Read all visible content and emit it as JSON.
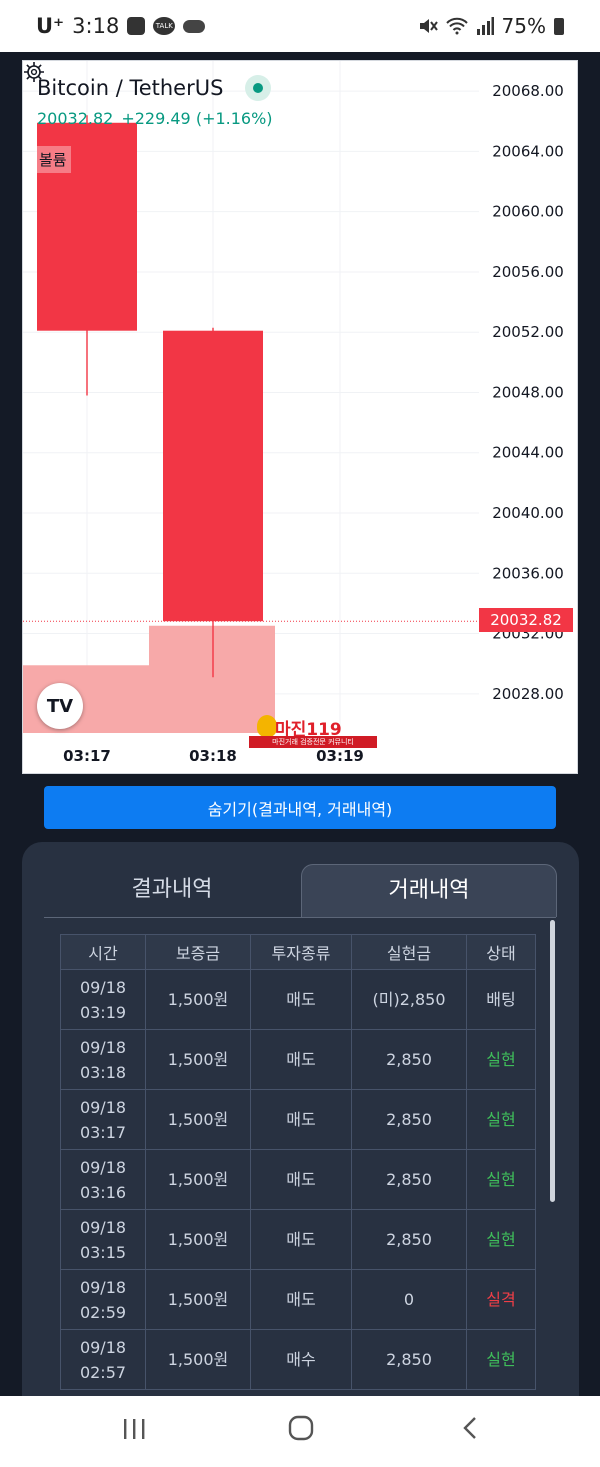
{
  "status_bar": {
    "carrier": "U⁺",
    "time": "3:18",
    "talk_icon_text": "TALK",
    "battery": "75%"
  },
  "chart": {
    "pair": "Bitcoin / TetherUS",
    "price": "20032.82",
    "change": "+229.49 (+1.16%)",
    "volume_label": "볼륨",
    "last_price_tag": "20032.82",
    "brand_logo_text": "TV"
  },
  "watermark": {
    "text": "마진119",
    "subtext": "마진거래 검증전문 커뮤니티"
  },
  "chart_data": {
    "type": "candlestick",
    "x": [
      "03:17",
      "03:18",
      "03:19"
    ],
    "y_ticks": [
      "20068.00",
      "20064.00",
      "20060.00",
      "20056.00",
      "20052.00",
      "20048.00",
      "20044.00",
      "20040.00",
      "20036.00",
      "20032.00",
      "20028.00"
    ],
    "ylim": [
      20025.4,
      20070.0
    ],
    "candles": [
      {
        "time": "03:17",
        "open": 20065.9,
        "high": 20066.4,
        "low": 20047.8,
        "close": 20052.1
      },
      {
        "time": "03:18",
        "open": 20052.1,
        "high": 20052.3,
        "low": 20029.1,
        "close": 20032.82
      }
    ],
    "volume": [
      {
        "time": "03:17",
        "relative": 0.48
      },
      {
        "time": "03:18",
        "relative": 0.76
      }
    ],
    "last_price": 20032.82,
    "colors": {
      "down": "#f23645",
      "volume_down": "#f7a9a9",
      "up": "#089981"
    },
    "grid": true
  },
  "hide_button": "숨기기(결과내역, 거래내역)",
  "tabs": [
    {
      "label": "결과내역",
      "active": false
    },
    {
      "label": "거래내역",
      "active": true
    }
  ],
  "table": {
    "headers": [
      "시간",
      "보증금",
      "투자종류",
      "실현금",
      "상태"
    ],
    "rows": [
      {
        "date": "09/18",
        "time": "03:19",
        "deposit": "1,500원",
        "type": "매도",
        "realized": "(미)2,850",
        "status": "배팅",
        "status_color": "#cdd4e0"
      },
      {
        "date": "09/18",
        "time": "03:18",
        "deposit": "1,500원",
        "type": "매도",
        "realized": "2,850",
        "status": "실현",
        "status_color": "#3fbe5a"
      },
      {
        "date": "09/18",
        "time": "03:17",
        "deposit": "1,500원",
        "type": "매도",
        "realized": "2,850",
        "status": "실현",
        "status_color": "#3fbe5a"
      },
      {
        "date": "09/18",
        "time": "03:16",
        "deposit": "1,500원",
        "type": "매도",
        "realized": "2,850",
        "status": "실현",
        "status_color": "#3fbe5a"
      },
      {
        "date": "09/18",
        "time": "03:15",
        "deposit": "1,500원",
        "type": "매도",
        "realized": "2,850",
        "status": "실현",
        "status_color": "#3fbe5a"
      },
      {
        "date": "09/18",
        "time": "02:59",
        "deposit": "1,500원",
        "type": "매도",
        "realized": "0",
        "status": "실격",
        "status_color": "#ef3e47"
      },
      {
        "date": "09/18",
        "time": "02:57",
        "deposit": "1,500원",
        "type": "매수",
        "realized": "2,850",
        "status": "실현",
        "status_color": "#3fbe5a"
      }
    ]
  },
  "nav": {
    "recents": "|||",
    "home": "○",
    "back": "‹"
  }
}
